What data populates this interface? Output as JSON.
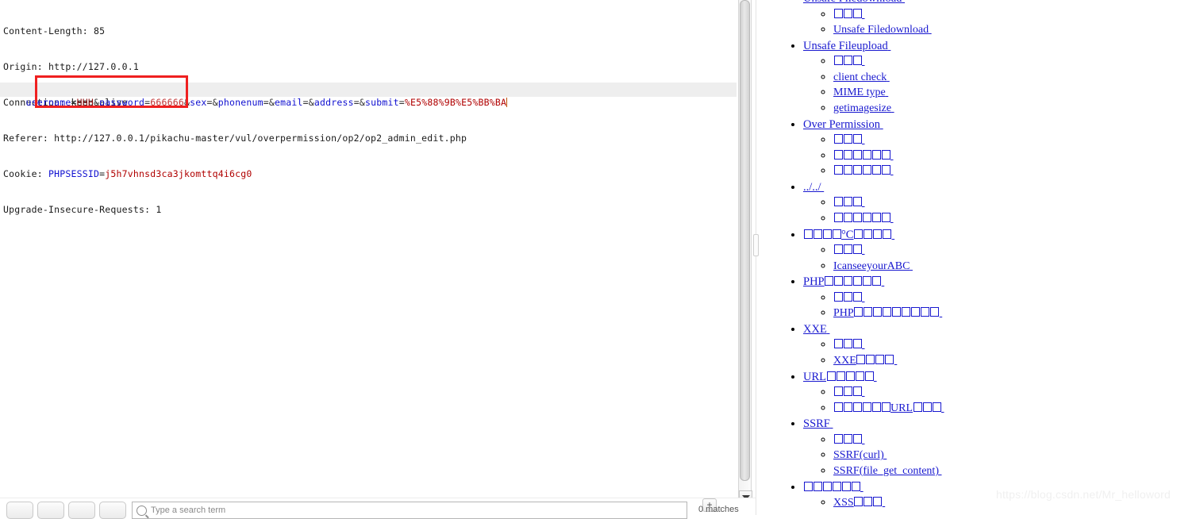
{
  "request": {
    "headers": [
      {
        "text": "Content-Length: 85"
      },
      {
        "text": "Origin: http://127.0.0.1"
      },
      {
        "text": "Connection: keep-alive"
      },
      {
        "text": "Referer: http://127.0.0.1/pikachu-master/vul/overpermission/op2/op2_admin_edit.php"
      },
      {
        "name": "Cookie: ",
        "key": "PHPSESSID",
        "eq": "=",
        "value": "j5h7vhnsd3ca3jkomttq4i6cg0"
      },
      {
        "text": "Upgrade-Insecure-Requests: 1"
      }
    ],
    "body_params": [
      {
        "key": "username",
        "value": "HHH"
      },
      {
        "key": "password",
        "value": "666666"
      },
      {
        "key": "sex",
        "value": ""
      },
      {
        "key": "phonenum",
        "value": ""
      },
      {
        "key": "email",
        "value": ""
      },
      {
        "key": "address",
        "value": ""
      },
      {
        "key": "submit",
        "value": "%E5%88%9B%E5%BB%BA"
      }
    ],
    "body_raw": "username=HHH&password=666666&sex=&phonenum=&email=&address=&submit=%E5%88%9B%E5%BB%BA",
    "annotation": {
      "label": "red-highlight-box",
      "color": "#ef2020"
    }
  },
  "toolbar": {
    "buttons": [
      "btn-1",
      "btn-2",
      "btn-3",
      "btn-4"
    ],
    "search_placeholder": "Type a search term",
    "search_value": "",
    "plus_label": "+",
    "matches_label": "0 matches"
  },
  "scrollbar": {
    "down_arrow": "scroll-down-arrow"
  },
  "nav": {
    "groups": [
      {
        "label_parts": [
          {
            "t": "Unsafe Filedownload"
          }
        ],
        "children": [
          {
            "label_parts": [
              {
                "tofu": 3
              }
            ]
          },
          {
            "label_parts": [
              {
                "t": "Unsafe Filedownload"
              }
            ]
          }
        ]
      },
      {
        "label_parts": [
          {
            "t": "Unsafe Fileupload"
          }
        ],
        "children": [
          {
            "label_parts": [
              {
                "tofu": 3
              }
            ]
          },
          {
            "label_parts": [
              {
                "t": "client check"
              }
            ]
          },
          {
            "label_parts": [
              {
                "t": "MIME type"
              }
            ]
          },
          {
            "label_parts": [
              {
                "t": "getimagesize"
              }
            ]
          }
        ]
      },
      {
        "label_parts": [
          {
            "t": "Over Permission"
          }
        ],
        "children": [
          {
            "label_parts": [
              {
                "tofu": 3
              }
            ]
          },
          {
            "label_parts": [
              {
                "tofu": 6
              }
            ]
          },
          {
            "label_parts": [
              {
                "tofu": 6
              }
            ]
          }
        ]
      },
      {
        "label_parts": [
          {
            "t": "../../"
          }
        ],
        "children": [
          {
            "label_parts": [
              {
                "tofu": 3
              }
            ]
          },
          {
            "label_parts": [
              {
                "tofu": 6
              }
            ]
          }
        ]
      },
      {
        "label_parts": [
          {
            "tofu": 4
          },
          {
            "t": "°C"
          },
          {
            "tofu": 4
          }
        ],
        "children": [
          {
            "label_parts": [
              {
                "tofu": 3
              }
            ]
          },
          {
            "label_parts": [
              {
                "t": "IcanseeyourABC"
              }
            ]
          }
        ]
      },
      {
        "label_parts": [
          {
            "t": "PHP"
          },
          {
            "tofu": 6
          }
        ],
        "children": [
          {
            "label_parts": [
              {
                "tofu": 3
              }
            ]
          },
          {
            "label_parts": [
              {
                "t": "PHP"
              },
              {
                "tofu": 9
              }
            ]
          }
        ]
      },
      {
        "label_parts": [
          {
            "t": "XXE"
          }
        ],
        "children": [
          {
            "label_parts": [
              {
                "tofu": 3
              }
            ]
          },
          {
            "label_parts": [
              {
                "t": "XXE"
              },
              {
                "tofu": 4
              }
            ]
          }
        ]
      },
      {
        "label_parts": [
          {
            "t": "URL"
          },
          {
            "tofu": 5
          }
        ],
        "children": [
          {
            "label_parts": [
              {
                "tofu": 3
              }
            ]
          },
          {
            "label_parts": [
              {
                "tofu": 6
              },
              {
                "t": "URL"
              },
              {
                "tofu": 3
              }
            ]
          }
        ]
      },
      {
        "label_parts": [
          {
            "t": "SSRF"
          }
        ],
        "children": [
          {
            "label_parts": [
              {
                "tofu": 3
              }
            ]
          },
          {
            "label_parts": [
              {
                "t": "SSRF(curl)"
              }
            ]
          },
          {
            "label_parts": [
              {
                "t": "SSRF(file_get_content)"
              }
            ]
          }
        ]
      },
      {
        "label_parts": [
          {
            "tofu": 6
          }
        ],
        "children": [
          {
            "label_parts": [
              {
                "t": "XSS"
              },
              {
                "tofu": 3
              }
            ]
          }
        ]
      }
    ]
  },
  "watermark": {
    "text": "https://blog.csdn.net/Mr_helloword"
  }
}
